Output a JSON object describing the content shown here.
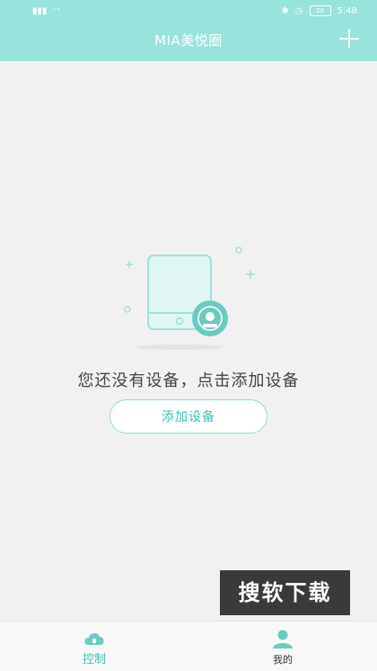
{
  "status_bar": {
    "signal": "Ⅲ",
    "wifi": "wifi",
    "time": "5:48",
    "battery": "28"
  },
  "header": {
    "title": "MIA美悦圈"
  },
  "empty_state": {
    "message": "您还没有设备，点击添加设备",
    "button_label": "添加设备"
  },
  "watermark": {
    "text": "搜软下载"
  },
  "tabbar": {
    "items": [
      {
        "label": "控制"
      },
      {
        "label": "我的"
      }
    ]
  },
  "colors": {
    "accent": "#98e3dc",
    "accent_text": "#3fc0b2",
    "background": "#f1f1f1"
  }
}
